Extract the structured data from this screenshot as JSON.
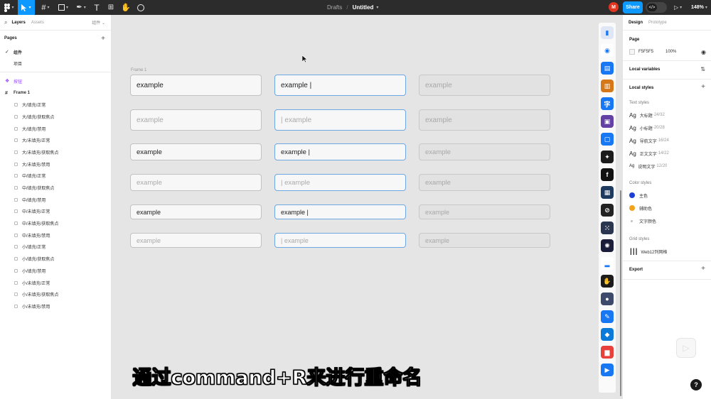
{
  "toolbar": {
    "main_menu_icon": "figma-logo-icon",
    "tools": [
      "move-tool",
      "frame-tool",
      "shape-tool",
      "pen-tool",
      "text-tool",
      "resources-tool",
      "hand-tool",
      "comment-tool"
    ],
    "breadcrumb_folder": "Drafts",
    "breadcrumb_sep": "/",
    "file_title": "Untitled",
    "avatar_initial": "M",
    "share_label": "Share",
    "dev_mode_glyph": "</>",
    "zoom_label": "148%",
    "accent_color": "#0d99ff"
  },
  "left_panel": {
    "tab_layers": "Layers",
    "tab_assets": "Assets",
    "components_tab": "组件 ⌄",
    "pages_title": "Pages",
    "pages": [
      {
        "label": "组件",
        "selected": true
      },
      {
        "label": "项目",
        "selected": false
      }
    ],
    "component_layer": "按钮",
    "frame_layer": "Frame 1",
    "frame_children": [
      "大/填充/正常",
      "大/填充/获取焦点",
      "大/填充/禁用",
      "大/未填充/正常",
      "大/未填充/获取焦点",
      "大/未填充/禁用",
      "中/填充/正常",
      "中/填充/获取焦点",
      "中/填充/禁用",
      "中/未填充/正常",
      "中/未填充/获取焦点",
      "中/未填充/禁用",
      "小/填充/正常",
      "小/填充/获取焦点",
      "小/填充/禁用",
      "小/未填充/正常",
      "小/未填充/获取焦点",
      "小/未填充/禁用"
    ]
  },
  "canvas": {
    "frame_label": "Frame 1",
    "rows": [
      {
        "normal": "example",
        "focus": "example |",
        "disabled": "example",
        "normal_ph": false,
        "focus_ph": false
      },
      {
        "normal": "example",
        "focus": "| example",
        "disabled": "example",
        "normal_ph": true,
        "focus_ph": true
      },
      {
        "normal": "example",
        "focus": "example |",
        "disabled": "example",
        "normal_ph": false,
        "focus_ph": false
      },
      {
        "normal": "example",
        "focus": "| example",
        "disabled": "example",
        "normal_ph": true,
        "focus_ph": true
      },
      {
        "normal": "example",
        "focus": "example |",
        "disabled": "example",
        "normal_ph": false,
        "focus_ph": false
      },
      {
        "normal": "example",
        "focus": "| example",
        "disabled": "example",
        "normal_ph": true,
        "focus_ph": true
      }
    ],
    "caption": "通过command+R来进行重命名"
  },
  "plugins": [
    {
      "name": "plugin-layout-icon",
      "color": "#dfe6f5",
      "glyph": "▮"
    },
    {
      "name": "plugin-eye-icon",
      "color": "#ffffff",
      "glyph": "◉"
    },
    {
      "name": "plugin-document-icon",
      "color": "#1877f2",
      "glyph": "▤"
    },
    {
      "name": "plugin-film-icon",
      "color": "#d4781a",
      "glyph": "▥"
    },
    {
      "name": "plugin-zi-character-icon",
      "color": "#1877f2",
      "glyph": "字"
    },
    {
      "name": "plugin-twitch-icon",
      "color": "#6441a5",
      "glyph": "▣"
    },
    {
      "name": "plugin-frame-icon",
      "color": "#1877f2",
      "glyph": "▢"
    },
    {
      "name": "plugin-component-icon",
      "color": "#1c1c1c",
      "glyph": "✦"
    },
    {
      "name": "plugin-font-icon",
      "color": "#111111",
      "glyph": "f"
    },
    {
      "name": "plugin-grid-icon",
      "color": "#1f3a5f",
      "glyph": "▦"
    },
    {
      "name": "plugin-link-icon",
      "color": "#222222",
      "glyph": "⊘"
    },
    {
      "name": "plugin-dots-icon",
      "color": "#2a3550",
      "glyph": "⁙"
    },
    {
      "name": "plugin-sun-icon",
      "color": "#1b1b3a",
      "glyph": "✺"
    },
    {
      "name": "plugin-tray-icon",
      "color": "#ffffff",
      "glyph": "▂"
    },
    {
      "name": "plugin-hand-icon",
      "color": "#1c1c1c",
      "glyph": "✋"
    },
    {
      "name": "plugin-avatar-icon",
      "color": "#3d4a6b",
      "glyph": "●"
    },
    {
      "name": "plugin-feather-icon",
      "color": "#1877f2",
      "glyph": "✎"
    },
    {
      "name": "plugin-cube-icon",
      "color": "#0b7ad8",
      "glyph": "◆"
    },
    {
      "name": "plugin-chart-icon",
      "color": "#e8403a",
      "glyph": "▆"
    },
    {
      "name": "plugin-truck-icon",
      "color": "#1877f2",
      "glyph": "▶"
    }
  ],
  "right_panel": {
    "tab_design": "Design",
    "tab_prototype": "Prototype",
    "page_title": "Page",
    "page_color_hex": "F5F5F5",
    "page_color_opacity": "100%",
    "local_variables": "Local variables",
    "local_styles": "Local styles",
    "text_styles_title": "Text styles",
    "text_styles": [
      {
        "ag": "Ag",
        "name": "大标题",
        "spec": "24/32"
      },
      {
        "ag": "Ag",
        "name": "小标题",
        "spec": "20/28"
      },
      {
        "ag": "Ag",
        "name": "导航文字",
        "spec": "16/24"
      },
      {
        "ag": "Ag",
        "name": "正文文字",
        "spec": "14/22"
      },
      {
        "ag": "Ag",
        "name": "说明文字",
        "spec": "12/20"
      }
    ],
    "color_styles_title": "Color styles",
    "color_styles": [
      {
        "name": "主色",
        "color": "#1d3fd6"
      },
      {
        "name": "辅助色",
        "color": "#f2a21b"
      },
      {
        "name": "文字颜色",
        "color": "#bfbfbf"
      }
    ],
    "grid_styles_title": "Grid styles",
    "grid_style": "Web12列网格",
    "export_title": "Export"
  }
}
